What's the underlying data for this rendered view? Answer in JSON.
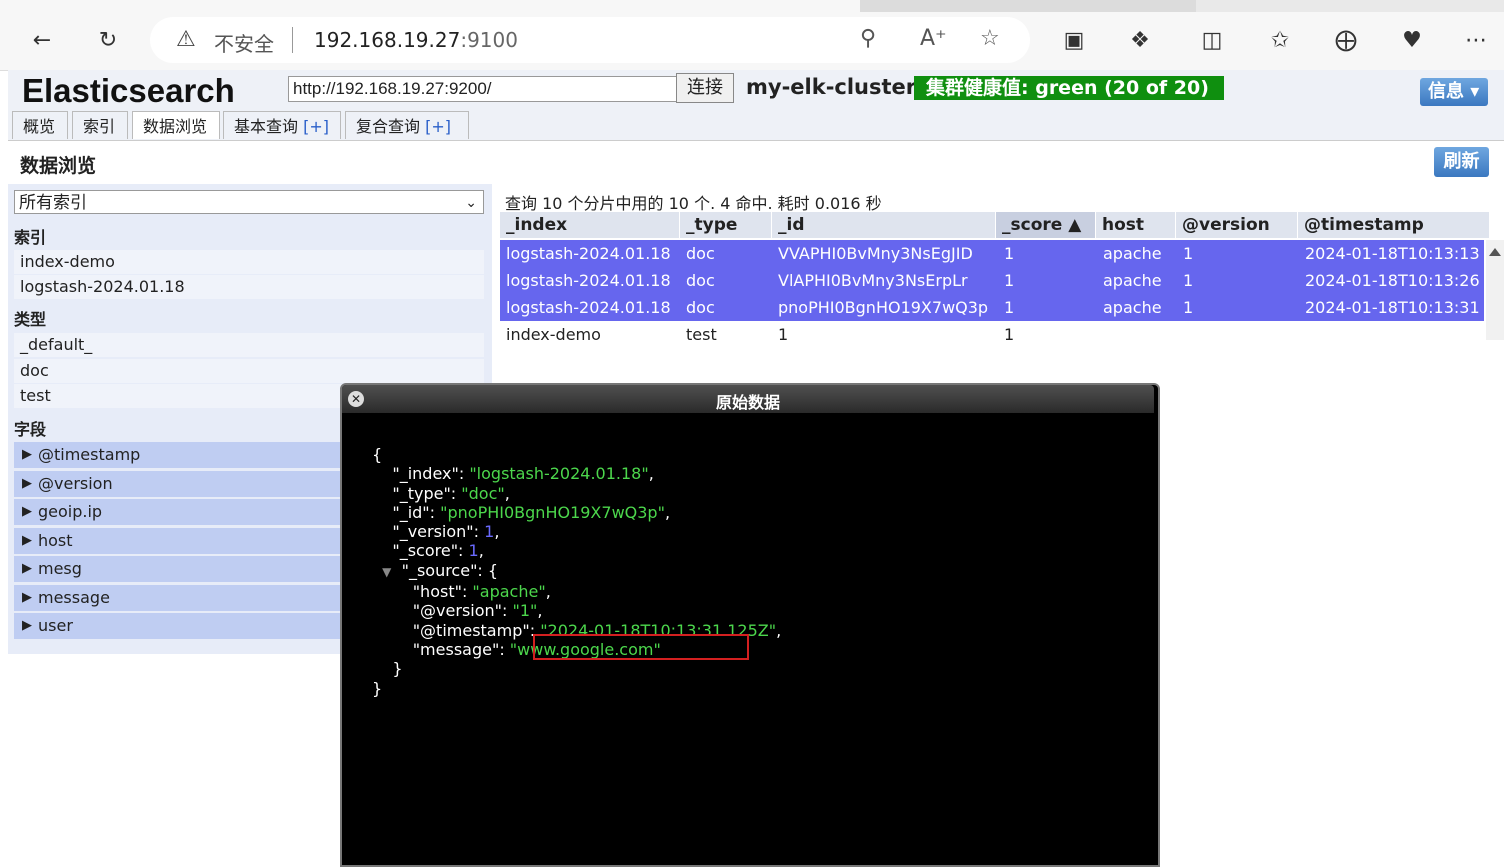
{
  "browser": {
    "security_label": "不安全",
    "url_host": "192.168.19.27",
    "url_port": ":9100"
  },
  "es": {
    "title": "Elasticsearch",
    "connect_url": "http://192.168.19.27:9200/",
    "connect_label": "连接",
    "cluster_name": "my-elk-cluster",
    "health": "集群健康值: green (20 of 20)",
    "health_color": "#0f8f0f",
    "info_label": "信息",
    "tabs": [
      {
        "label": "概览"
      },
      {
        "label": "索引"
      },
      {
        "label": "数据浏览"
      },
      {
        "label": "基本查询",
        "plus": "[+]"
      },
      {
        "label": "复合查询",
        "plus": "[+]"
      }
    ],
    "active_tab": "数据浏览",
    "section_title": "数据浏览",
    "refresh_label": "刷新"
  },
  "sidebar": {
    "index_select": "所有索引",
    "indices_heading": "索引",
    "indices": [
      "index-demo",
      "logstash-2024.01.18"
    ],
    "types_heading": "类型",
    "types": [
      "_default_",
      "doc",
      "test"
    ],
    "fields_heading": "字段",
    "fields": [
      "@timestamp",
      "@version",
      "geoip.ip",
      "host",
      "mesg",
      "message",
      "user"
    ]
  },
  "results": {
    "summary": "查询 10 个分片中用的 10 个. 4 命中. 耗时 0.016 秒",
    "columns": [
      "_index",
      "_type",
      "_id",
      "_score ▲",
      "host",
      "@version",
      "@timestamp"
    ],
    "rows": [
      [
        "logstash-2024.01.18",
        "doc",
        "VVAPHI0BvMny3NsEgJID",
        "1",
        "apache",
        "1",
        "2024-01-18T10:13:13"
      ],
      [
        "logstash-2024.01.18",
        "doc",
        "VlAPHI0BvMny3NsErpLr",
        "1",
        "apache",
        "1",
        "2024-01-18T10:13:26"
      ],
      [
        "logstash-2024.01.18",
        "doc",
        "pnoPHI0BgnHO19X7wQ3p",
        "1",
        "apache",
        "1",
        "2024-01-18T10:13:31"
      ],
      [
        "index-demo",
        "test",
        "1",
        "1",
        "",
        "",
        ""
      ]
    ],
    "selected_color": "#6666ee"
  },
  "modal": {
    "title": "原始数据",
    "json": {
      "index": "\"logstash-2024.01.18\"",
      "type": "\"doc\"",
      "id": "\"pnoPHI0BgnHO19X7wQ3p\"",
      "version": "1",
      "score": "1",
      "host": "\"apache\"",
      "at_version": "\"1\"",
      "timestamp": "\"2024-01-18T10:13:31.125Z\"",
      "message": "\"www.google.com\""
    }
  }
}
